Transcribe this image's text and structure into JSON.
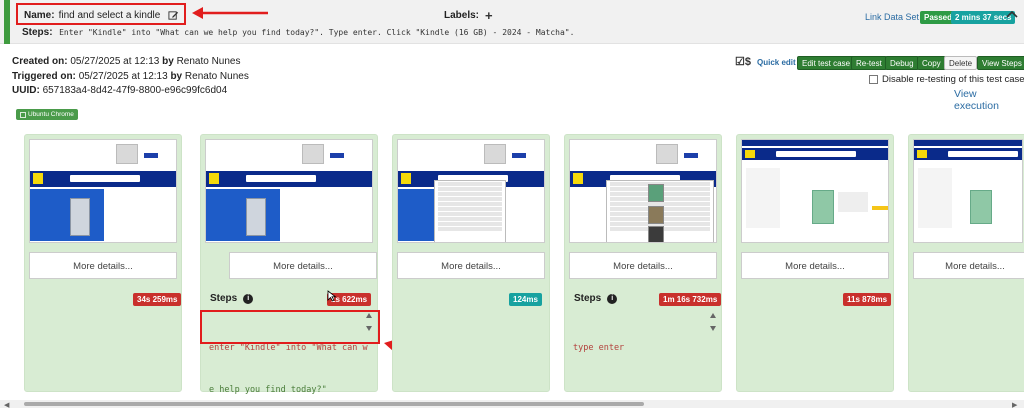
{
  "header": {
    "name_label": "Name:",
    "name_value": "find and select a kindle",
    "labels_label": "Labels:",
    "steps_label": "Steps:",
    "steps_text": "Enter \"Kindle\" into \"What can we help you find today?\". Type enter. Click \"Kindle (16 GB) - 2024 - Matcha\".",
    "link_data_set": "Link Data Set",
    "status_badge": "Passed",
    "duration_badge": "2 mins 37 secs"
  },
  "meta": {
    "created_label": "Created on:",
    "created_value": "05/27/2025 at 12:13",
    "created_by_label": "by",
    "created_by": "Renato Nunes",
    "triggered_label": "Triggered on:",
    "triggered_value": "05/27/2025 at 12:13",
    "triggered_by_label": "by",
    "triggered_by": "Renato Nunes",
    "uuid_label": "UUID:",
    "uuid_value": "657183a4-8d42-47f9-8800-e96c99fc6d04",
    "env_tag": "Ubuntu Chrome"
  },
  "toolbar": {
    "quick_edit": "Quick edit",
    "edit": "Edit test case",
    "retest": "Re-test",
    "debug": "Debug",
    "copy": "Copy",
    "delete": "Delete",
    "view_steps": "View Steps",
    "disable_retest": "Disable re-testing of this test case",
    "view_execution": "View execution"
  },
  "cards": [
    {
      "more": "More details...",
      "duration": "34s 259ms"
    },
    {
      "more": "More details...",
      "steps_label": "Steps",
      "duration": "1s 622ms",
      "code_line1": "enter \"Kindle\" into \"What can w",
      "code_line2": "e help you find today?\""
    },
    {
      "more": "More details...",
      "duration": "124ms"
    },
    {
      "more": "More details...",
      "steps_label": "Steps",
      "duration": "1m 16s 732ms",
      "code_line1": "type enter"
    },
    {
      "more": "More details...",
      "duration": "11s 878ms"
    },
    {
      "more": "More details..."
    }
  ],
  "colors": {
    "accent_red": "#e11d1d",
    "pass_green": "#2e9b45",
    "teal": "#17a2a0",
    "card_bg": "#d8ecd3"
  }
}
